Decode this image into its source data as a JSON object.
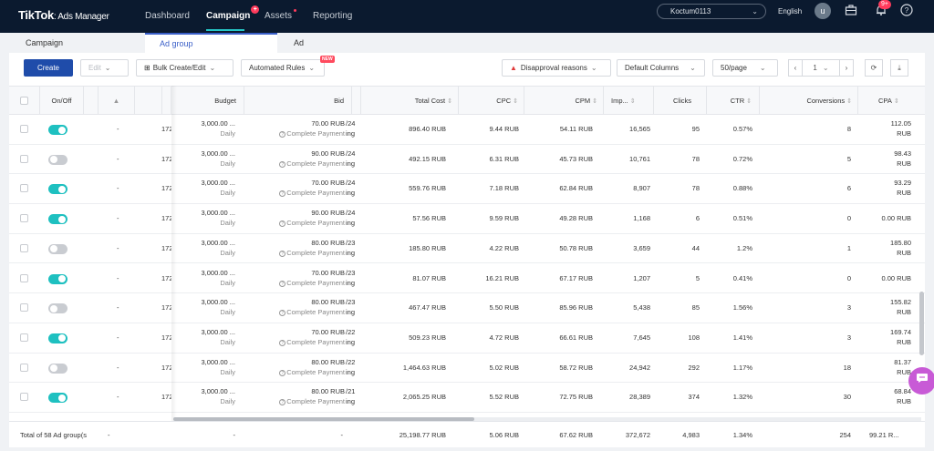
{
  "app": {
    "logo": "TikTok",
    "logo_sub": ": Ads Manager",
    "nav": [
      {
        "label": "Dashboard"
      },
      {
        "label": "Campaign"
      },
      {
        "label": "Assets"
      },
      {
        "label": "Reporting"
      }
    ],
    "account": "Koctum0113",
    "language": "English",
    "avatar_letter": "u",
    "notification_badge": "9+",
    "colors": {
      "topbar": "#0b1a2f",
      "accent": "#1f4caa",
      "toggle_on": "#1ec0c0",
      "alert": "#ff3b5c"
    }
  },
  "level_tabs": [
    {
      "label": "Campaign"
    },
    {
      "label": "Ad group"
    },
    {
      "label": "Ad"
    }
  ],
  "toolbar": {
    "create": "Create",
    "edit": "Edit",
    "bulk": "Bulk Create/Edit",
    "automated_rules": "Automated Rules",
    "new_tag": "NEW",
    "disapproval": "Disapproval reasons",
    "columns": "Default Columns",
    "per_page": "50/page",
    "page_number": "1"
  },
  "table": {
    "headers": {
      "onoff": "On/Off",
      "budget": "Budget",
      "bid": "Bid",
      "total_cost": "Total Cost",
      "cpc": "CPC",
      "cpm": "CPM",
      "impressions": "Imp...",
      "clicks": "Clicks",
      "ctr": "CTR",
      "conversions": "Conversions",
      "cpa": "CPA"
    },
    "rows": [
      {
        "on": true,
        "status": "-",
        "id": "172",
        "budget": "3,000.00 ...",
        "budget_type": "Daily",
        "bid": "70.00 RUB",
        "bid_goal": "Complete Payment",
        "date": "/24",
        "sched": "ing",
        "total_cost": "896.40 RUB",
        "cpc": "9.44 RUB",
        "cpm": "54.11 RUB",
        "impressions": "16,565",
        "clicks": "95",
        "ctr": "0.57%",
        "conversions": "8",
        "cpa": "112.05",
        "cpa_unit": "RUB"
      },
      {
        "on": false,
        "status": "-",
        "id": "172",
        "budget": "3,000.00 ...",
        "budget_type": "Daily",
        "bid": "90.00 RUB",
        "bid_goal": "Complete Payment",
        "date": "/24",
        "sched": "ing",
        "total_cost": "492.15 RUB",
        "cpc": "6.31 RUB",
        "cpm": "45.73 RUB",
        "impressions": "10,761",
        "clicks": "78",
        "ctr": "0.72%",
        "conversions": "5",
        "cpa": "98.43",
        "cpa_unit": "RUB"
      },
      {
        "on": true,
        "status": "-",
        "id": "172",
        "budget": "3,000.00 ...",
        "budget_type": "Daily",
        "bid": "70.00 RUB",
        "bid_goal": "Complete Payment",
        "date": "/24",
        "sched": "ing",
        "total_cost": "559.76 RUB",
        "cpc": "7.18 RUB",
        "cpm": "62.84 RUB",
        "impressions": "8,907",
        "clicks": "78",
        "ctr": "0.88%",
        "conversions": "6",
        "cpa": "93.29",
        "cpa_unit": "RUB"
      },
      {
        "on": true,
        "status": "-",
        "id": "172",
        "budget": "3,000.00 ...",
        "budget_type": "Daily",
        "bid": "90.00 RUB",
        "bid_goal": "Complete Payment",
        "date": "/24",
        "sched": "ing",
        "total_cost": "57.56 RUB",
        "cpc": "9.59 RUB",
        "cpm": "49.28 RUB",
        "impressions": "1,168",
        "clicks": "6",
        "ctr": "0.51%",
        "conversions": "0",
        "cpa": "0.00 RUB",
        "cpa_unit": ""
      },
      {
        "on": false,
        "status": "-",
        "id": "172",
        "budget": "3,000.00 ...",
        "budget_type": "Daily",
        "bid": "80.00 RUB",
        "bid_goal": "Complete Payment",
        "date": "/23",
        "sched": "ing",
        "total_cost": "185.80 RUB",
        "cpc": "4.22 RUB",
        "cpm": "50.78 RUB",
        "impressions": "3,659",
        "clicks": "44",
        "ctr": "1.2%",
        "conversions": "1",
        "cpa": "185.80",
        "cpa_unit": "RUB"
      },
      {
        "on": true,
        "status": "-",
        "id": "172",
        "budget": "3,000.00 ...",
        "budget_type": "Daily",
        "bid": "70.00 RUB",
        "bid_goal": "Complete Payment",
        "date": "/23",
        "sched": "ing",
        "total_cost": "81.07 RUB",
        "cpc": "16.21 RUB",
        "cpm": "67.17 RUB",
        "impressions": "1,207",
        "clicks": "5",
        "ctr": "0.41%",
        "conversions": "0",
        "cpa": "0.00 RUB",
        "cpa_unit": ""
      },
      {
        "on": false,
        "status": "-",
        "id": "172",
        "budget": "3,000.00 ...",
        "budget_type": "Daily",
        "bid": "80.00 RUB",
        "bid_goal": "Complete Payment",
        "date": "/23",
        "sched": "ing",
        "total_cost": "467.47 RUB",
        "cpc": "5.50 RUB",
        "cpm": "85.96 RUB",
        "impressions": "5,438",
        "clicks": "85",
        "ctr": "1.56%",
        "conversions": "3",
        "cpa": "155.82",
        "cpa_unit": "RUB"
      },
      {
        "on": true,
        "status": "-",
        "id": "172",
        "budget": "3,000.00 ...",
        "budget_type": "Daily",
        "bid": "70.00 RUB",
        "bid_goal": "Complete Payment",
        "date": "/22",
        "sched": "ing",
        "total_cost": "509.23 RUB",
        "cpc": "4.72 RUB",
        "cpm": "66.61 RUB",
        "impressions": "7,645",
        "clicks": "108",
        "ctr": "1.41%",
        "conversions": "3",
        "cpa": "169.74",
        "cpa_unit": "RUB"
      },
      {
        "on": false,
        "status": "-",
        "id": "172",
        "budget": "3,000.00 ...",
        "budget_type": "Daily",
        "bid": "80.00 RUB",
        "bid_goal": "Complete Payment",
        "date": "/22",
        "sched": "ing",
        "total_cost": "1,464.63 RUB",
        "cpc": "5.02 RUB",
        "cpm": "58.72 RUB",
        "impressions": "24,942",
        "clicks": "292",
        "ctr": "1.17%",
        "conversions": "18",
        "cpa": "81.37",
        "cpa_unit": "RUB"
      },
      {
        "on": true,
        "status": "-",
        "id": "172",
        "budget": "3,000.00 ...",
        "budget_type": "Daily",
        "bid": "80.00 RUB",
        "bid_goal": "Complete Payment",
        "date": "/21",
        "sched": "ing",
        "total_cost": "2,065.25 RUB",
        "cpc": "5.52 RUB",
        "cpm": "72.75 RUB",
        "impressions": "28,389",
        "clicks": "374",
        "ctr": "1.32%",
        "conversions": "30",
        "cpa": "68.84",
        "cpa_unit": "RUB"
      }
    ],
    "totals": {
      "label": "Total of 58 Ad group(s",
      "status": "-",
      "budget": "-",
      "bid": "-",
      "total_cost": "25,198.77 RUB",
      "cpc": "5.06 RUB",
      "cpm": "67.62 RUB",
      "impressions": "372,672",
      "clicks": "4,983",
      "ctr": "1.34%",
      "conversions": "254",
      "cpa": "99.21 R..."
    }
  }
}
